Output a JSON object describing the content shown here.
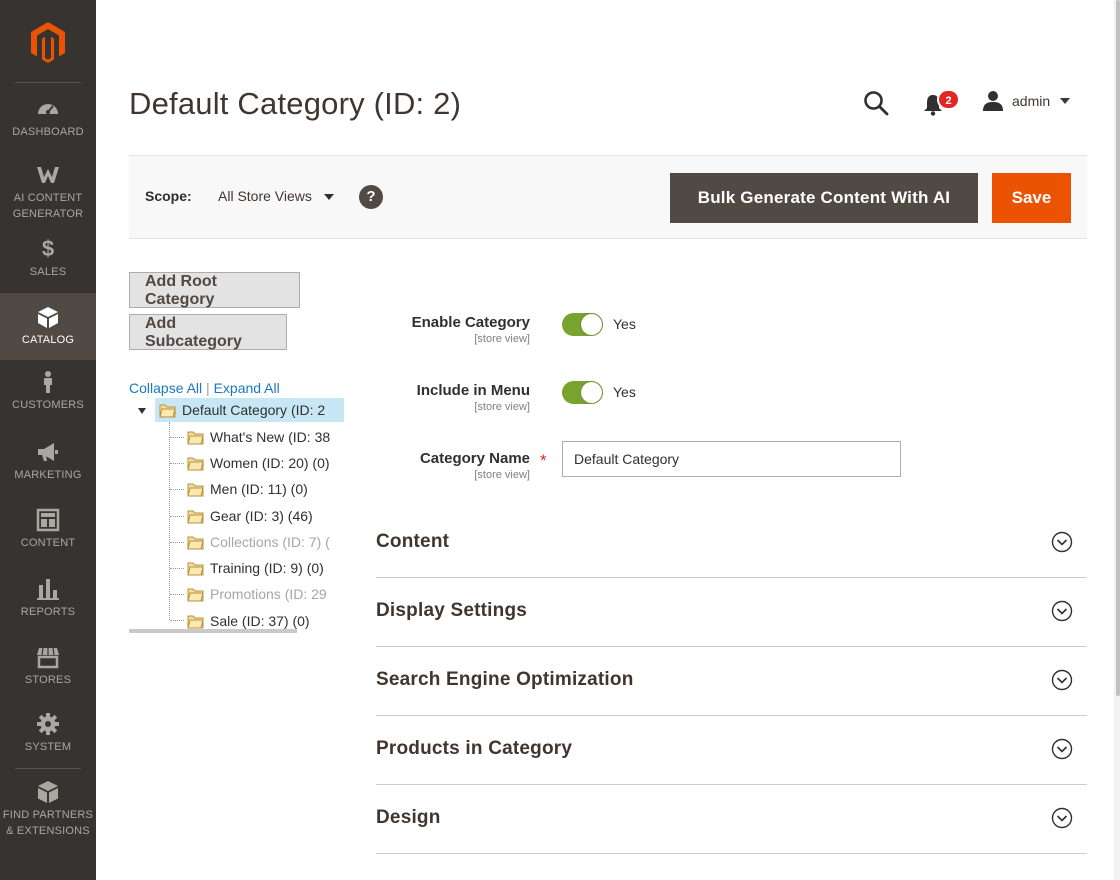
{
  "sidebar": {
    "logo": "magento-logo-icon",
    "items": [
      {
        "label": "DASHBOARD",
        "icon": "dashboard-icon"
      },
      {
        "label": "AI CONTENT GENERATOR",
        "icon": "ai-content-generator-icon"
      },
      {
        "label": "SALES",
        "icon": "dollar-icon"
      },
      {
        "label": "CATALOG",
        "icon": "catalog-box-icon",
        "active": true
      },
      {
        "label": "CUSTOMERS",
        "icon": "customer-person-icon"
      },
      {
        "label": "MARKETING",
        "icon": "megaphone-icon"
      },
      {
        "label": "CONTENT",
        "icon": "content-layout-icon"
      },
      {
        "label": "REPORTS",
        "icon": "bar-chart-icon"
      },
      {
        "label": "STORES",
        "icon": "storefront-icon"
      },
      {
        "label": "SYSTEM",
        "icon": "gear-icon"
      },
      {
        "label": "FIND PARTNERS & EXTENSIONS",
        "icon": "extensions-cube-icon"
      }
    ],
    "colors": {
      "background": "#373330",
      "active": "#514943",
      "accent": "#eb5202"
    }
  },
  "header": {
    "title": "Default Category (ID: 2)",
    "notifications_count": "2",
    "user": "admin"
  },
  "scope_bar": {
    "label": "Scope:",
    "selected": "All Store Views",
    "help": "?",
    "ai_button": "Bulk Generate Content With AI",
    "save_button": "Save"
  },
  "tree": {
    "add_root": "Add Root Category",
    "add_sub": "Add Subcategory",
    "collapse_all": "Collapse All",
    "separator": "|",
    "expand_all": "Expand All",
    "root": "Default Category (ID: 2",
    "children": [
      {
        "label": "What's New (ID: 38",
        "disabled": false
      },
      {
        "label": "Women (ID: 20) (0)",
        "disabled": false
      },
      {
        "label": "Men (ID: 11) (0)",
        "disabled": false
      },
      {
        "label": "Gear (ID: 3) (46)",
        "disabled": false
      },
      {
        "label": "Collections (ID: 7) (",
        "disabled": true
      },
      {
        "label": "Training (ID: 9) (0)",
        "disabled": false
      },
      {
        "label": "Promotions (ID: 29",
        "disabled": true
      },
      {
        "label": "Sale (ID: 37) (0)",
        "disabled": false
      }
    ]
  },
  "form": {
    "enable_category": {
      "label": "Enable Category",
      "scope": "[store view]",
      "value": "Yes",
      "enabled": true
    },
    "include_in_menu": {
      "label": "Include in Menu",
      "scope": "[store view]",
      "value": "Yes",
      "enabled": true
    },
    "category_name": {
      "label": "Category Name",
      "scope": "[store view]",
      "required": "*",
      "value": "Default Category"
    }
  },
  "sections": [
    {
      "title": "Content"
    },
    {
      "title": "Display Settings"
    },
    {
      "title": "Search Engine Optimization"
    },
    {
      "title": "Products in Category"
    },
    {
      "title": "Design"
    }
  ]
}
